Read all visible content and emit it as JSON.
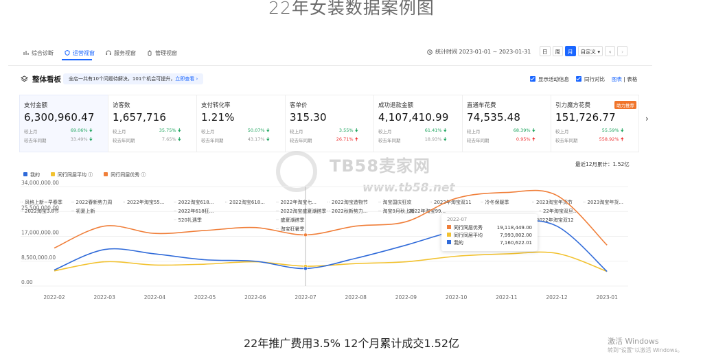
{
  "page_title": "22年女装数据案例图",
  "nav": {
    "tabs": [
      {
        "label": "综合诊断",
        "icon": "chart-icon"
      },
      {
        "label": "运营视窗",
        "icon": "shield-icon",
        "active": true
      },
      {
        "label": "服务视窗",
        "icon": "headset-icon"
      },
      {
        "label": "管理视窗",
        "icon": "bottle-icon"
      }
    ],
    "period_label": "统计时间 2023-01-01 ~ 2023-01-31",
    "period_buttons": [
      "日",
      "周",
      "月",
      "自定义"
    ],
    "period_active": "月"
  },
  "board": {
    "title": "整体看板",
    "notice_text": "全店一共有10个问题待解决，101个机会可提升，",
    "notice_link": "立即查看",
    "opt_activity": "显示活动信息",
    "opt_peer": "同行对比",
    "view_chart": "图表",
    "view_table": "表格"
  },
  "metrics": [
    {
      "label": "支付金额",
      "value": "6,300,960.47",
      "mom_label": "较上月",
      "mom": "69.06%",
      "mom_dir": "down",
      "yoy_label": "较去年同期",
      "yoy": "33.49%",
      "yoy_dir": "down"
    },
    {
      "label": "访客数",
      "value": "1,657,716",
      "mom_label": "较上月",
      "mom": "35.75%",
      "mom_dir": "down",
      "yoy_label": "较去年同期",
      "yoy": "7.65%",
      "yoy_dir": "down"
    },
    {
      "label": "支付转化率",
      "value": "1.21%",
      "mom_label": "较上月",
      "mom": "50.07%",
      "mom_dir": "down",
      "yoy_label": "较去年同期",
      "yoy": "43.17%",
      "yoy_dir": "down"
    },
    {
      "label": "客单价",
      "value": "315.30",
      "mom_label": "较上月",
      "mom": "3.55%",
      "mom_dir": "down",
      "yoy_label": "较去年同期",
      "yoy": "26.71%",
      "yoy_dir": "up"
    },
    {
      "label": "成功退款金额",
      "value": "4,107,410.99",
      "mom_label": "较上月",
      "mom": "61.41%",
      "mom_dir": "down",
      "yoy_label": "较去年同期",
      "yoy": "18.93%",
      "yoy_dir": "down"
    },
    {
      "label": "直通车花费",
      "value": "74,535.48",
      "mom_label": "较上月",
      "mom": "68.39%",
      "mom_dir": "down",
      "yoy_label": "较去年同期",
      "yoy": "0.95%",
      "yoy_dir": "up"
    },
    {
      "label": "引力魔方花费",
      "value": "151,726.77",
      "badge": "助力推荐",
      "mom_label": "较上月",
      "mom": "55.59%",
      "mom_dir": "down",
      "yoy_label": "较去年同期",
      "yoy": "558.92%",
      "yoy_dir": "up"
    }
  ],
  "total_label": "最近12月累计：1.52亿",
  "chart_data": {
    "type": "line",
    "x": [
      "2022-02",
      "2022-03",
      "2022-04",
      "2022-05",
      "2022-06",
      "2022-07",
      "2022-08",
      "2022-09",
      "2022-10",
      "2022-11",
      "2022-12",
      "2023-01"
    ],
    "yticks": [
      "34,000,000.00",
      "25,500,000.00",
      "17,000,000.00",
      "8,500,000.00",
      "0.00"
    ],
    "ylim": [
      0,
      34000000
    ],
    "series": [
      {
        "name": "我的",
        "color": "#2f6ad9",
        "values": [
          5500000,
          12500000,
          11000000,
          9000000,
          8500000,
          6000000,
          9500000,
          14000000,
          19000000,
          22000000,
          20500000,
          5000000
        ]
      },
      {
        "name": "同行同层平均",
        "color": "#f2c230",
        "values": [
          5200000,
          8300000,
          7200000,
          7500000,
          8300000,
          6800000,
          7700000,
          8300000,
          10200000,
          11000000,
          11200000,
          5000000
        ]
      },
      {
        "name": "同行同层优秀",
        "color": "#f07f3a",
        "values": [
          13000000,
          20500000,
          18000000,
          19000000,
          20000000,
          17500000,
          20500000,
          22000000,
          30000000,
          32000000,
          31000000,
          14000000
        ]
      }
    ],
    "events": [
      "风格上新~早春季",
      "2022春新势力周",
      "2022年淘宝55...",
      "2022淘宝618...",
      "2022淘宝618...",
      "2022年淘宝七...",
      "2022淘宝造物节",
      "淘宝国庆狂欢",
      "2022年淘宝双11",
      "冷冬保暖季",
      "2023淘宝年货节",
      "2023淘宝年货...",
      "2022淘宝3.8节",
      "初夏上新",
      "2022年618狂...",
      "2022淘宝盛夏潮搭季",
      "2022秋新势力...",
      "淘宝9月秋上新",
      "2022年淘宝99...",
      "22年淘宝双旦...",
      "520礼遇季",
      "盛夏潮搭季",
      "2022年淘宝双12",
      "淘宝狂暑季"
    ],
    "tooltip": {
      "title": "2022-07",
      "rows": [
        {
          "name": "同行同层优秀",
          "value": "19,118,449.00"
        },
        {
          "name": "同行同层平均",
          "value": "7,993,802.00"
        },
        {
          "name": "我的",
          "value": "7,160,622.01"
        }
      ]
    }
  },
  "watermark": {
    "text": "TB58麦家网",
    "url": "www.tb58.net"
  },
  "footer": "22年推广费用3.5% 12个月累计成交1.52亿",
  "activate": {
    "line1": "激活 Windows",
    "line2": "转到\"设置\"以激活 Windows。"
  }
}
